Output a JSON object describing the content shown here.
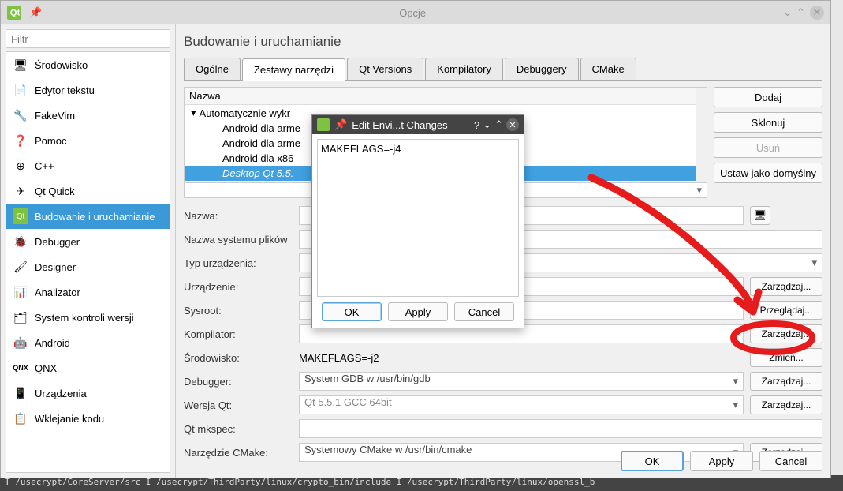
{
  "window": {
    "title": "Opcje"
  },
  "filter": {
    "placeholder": "Filtr"
  },
  "categories": [
    {
      "label": "Środowisko"
    },
    {
      "label": "Edytor tekstu"
    },
    {
      "label": "FakeVim"
    },
    {
      "label": "Pomoc"
    },
    {
      "label": "C++"
    },
    {
      "label": "Qt Quick"
    },
    {
      "label": "Budowanie i uruchamianie"
    },
    {
      "label": "Debugger"
    },
    {
      "label": "Designer"
    },
    {
      "label": "Analizator"
    },
    {
      "label": "System kontroli wersji"
    },
    {
      "label": "Android"
    },
    {
      "label": "QNX"
    },
    {
      "label": "Urządzenia"
    },
    {
      "label": "Wklejanie kodu"
    }
  ],
  "selected_category_index": 6,
  "page_title": "Budowanie i uruchamianie",
  "tabs": [
    {
      "label": "Ogólne"
    },
    {
      "label": "Zestawy narzędzi"
    },
    {
      "label": "Qt Versions"
    },
    {
      "label": "Kompilatory"
    },
    {
      "label": "Debuggery"
    },
    {
      "label": "CMake"
    }
  ],
  "active_tab_index": 1,
  "tree": {
    "header": "Nazwa",
    "root": "Automatycznie wykr",
    "children": [
      "Android dla arme",
      "Android dla arme",
      "Android dla x86",
      "Desktop Qt 5.5."
    ],
    "selected_index": 3
  },
  "side_buttons": {
    "add": "Dodaj",
    "clone": "Sklonuj",
    "remove": "Usuń",
    "default": "Ustaw jako domyślny"
  },
  "form": {
    "name_label": "Nazwa:",
    "fsname_label": "Nazwa systemu plików",
    "devtype_label": "Typ urządzenia:",
    "device_label": "Urządzenie:",
    "sysroot_label": "Sysroot:",
    "compiler_label": "Kompilator:",
    "env_label": "Środowisko:",
    "debugger_label": "Debugger:",
    "qtver_label": "Wersja Qt:",
    "mkspec_label": "Qt mkspec:",
    "cmake_label": "Narzędzie CMake:",
    "device_btn": "Zarządzaj...",
    "sysroot_btn": "Przeglądaj...",
    "compiler_btn": "Zarządzaj...",
    "env_btn": "Zmień...",
    "debugger_btn": "Zarządzaj...",
    "qtver_btn": "Zarządzaj...",
    "cmake_btn": "Zarządzaj...",
    "env_value": "MAKEFLAGS=-j2",
    "debugger_value": "System GDB w /usr/bin/gdb",
    "qtver_value": "Qt 5.5.1 GCC 64bit",
    "cmake_value": "Systemowy CMake w /usr/bin/cmake"
  },
  "bottom": {
    "ok": "OK",
    "apply": "Apply",
    "cancel": "Cancel"
  },
  "env_dialog": {
    "title": "Edit Envi...t Changes",
    "text": "MAKEFLAGS=-j4",
    "ok": "OK",
    "apply": "Apply",
    "cancel": "Cancel"
  },
  "terminal": "T   /usecrypt/CoreServer/src   I   /usecrypt/ThirdParty/linux/crypto_bin/include   I   /usecrypt/ThirdParty/linux/openssl_b"
}
